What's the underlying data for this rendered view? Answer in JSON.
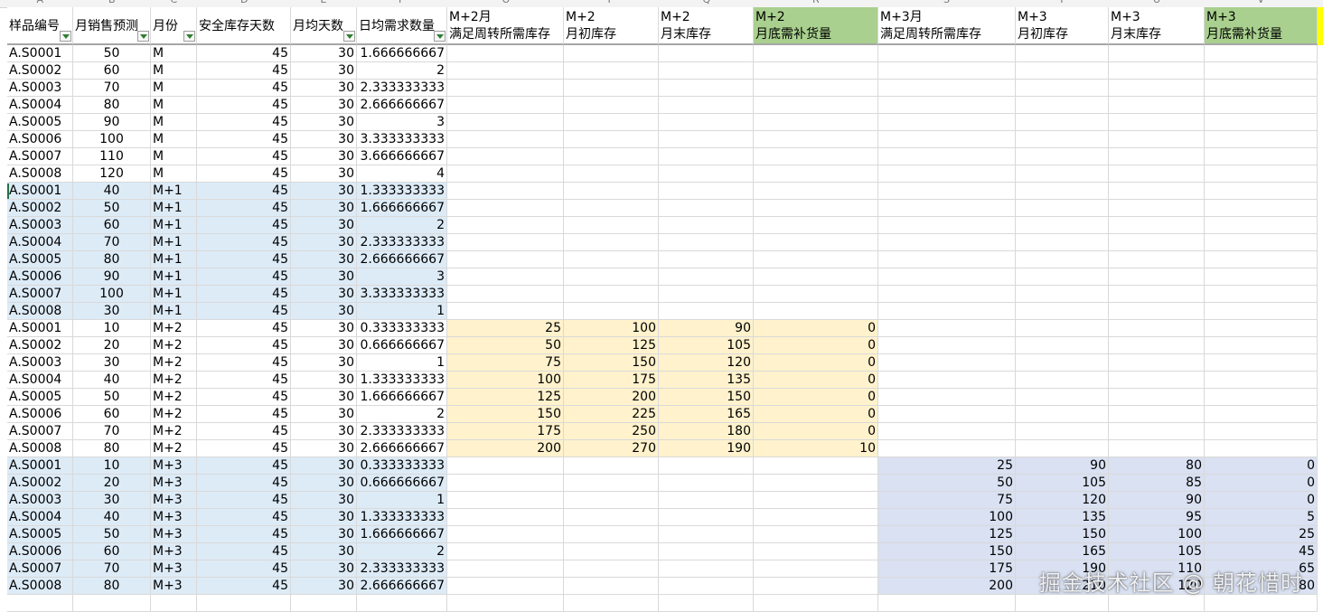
{
  "column_letters": [
    "A",
    "B",
    "C",
    "D",
    "E",
    "F",
    "O",
    "P",
    "Q",
    "R",
    "S",
    "T",
    "U",
    "V"
  ],
  "headers": {
    "sample_id": "样品编号",
    "monthly_forecast": "月销售预测",
    "month": "月份",
    "safety_days": "安全库存天数",
    "avg_days": "月均天数",
    "daily_demand": "日均需求数量",
    "m2_turnover_l1": "M+2月",
    "m2_turnover_l2": "满足周转所需库存",
    "m2_open_l1": "M+2",
    "m2_open_l2": "月初库存",
    "m2_close_l1": "M+2",
    "m2_close_l2": "月末库存",
    "m2_replen_l1": "M+2",
    "m2_replen_l2": "月底需补货量",
    "m3_turnover_l1": "M+3月",
    "m3_turnover_l2": "满足周转所需库存",
    "m3_open_l1": "M+3",
    "m3_open_l2": "月初库存",
    "m3_close_l1": "M+3",
    "m3_close_l2": "月末库存",
    "m3_replen_l1": "M+3",
    "m3_replen_l2": "月底需补货量"
  },
  "rows": [
    {
      "id": "A.S0001",
      "forecast": "50",
      "month": "M",
      "safety": "45",
      "avg": "30",
      "daily": "1.666666667"
    },
    {
      "id": "A.S0002",
      "forecast": "60",
      "month": "M",
      "safety": "45",
      "avg": "30",
      "daily": "2"
    },
    {
      "id": "A.S0003",
      "forecast": "70",
      "month": "M",
      "safety": "45",
      "avg": "30",
      "daily": "2.333333333"
    },
    {
      "id": "A.S0004",
      "forecast": "80",
      "month": "M",
      "safety": "45",
      "avg": "30",
      "daily": "2.666666667"
    },
    {
      "id": "A.S0005",
      "forecast": "90",
      "month": "M",
      "safety": "45",
      "avg": "30",
      "daily": "3"
    },
    {
      "id": "A.S0006",
      "forecast": "100",
      "month": "M",
      "safety": "45",
      "avg": "30",
      "daily": "3.333333333"
    },
    {
      "id": "A.S0007",
      "forecast": "110",
      "month": "M",
      "safety": "45",
      "avg": "30",
      "daily": "3.666666667"
    },
    {
      "id": "A.S0008",
      "forecast": "120",
      "month": "M",
      "safety": "45",
      "avg": "30",
      "daily": "4"
    },
    {
      "id": "A.S0001",
      "forecast": "40",
      "month": "M+1",
      "safety": "45",
      "avg": "30",
      "daily": "1.333333333"
    },
    {
      "id": "A.S0002",
      "forecast": "50",
      "month": "M+1",
      "safety": "45",
      "avg": "30",
      "daily": "1.666666667"
    },
    {
      "id": "A.S0003",
      "forecast": "60",
      "month": "M+1",
      "safety": "45",
      "avg": "30",
      "daily": "2"
    },
    {
      "id": "A.S0004",
      "forecast": "70",
      "month": "M+1",
      "safety": "45",
      "avg": "30",
      "daily": "2.333333333"
    },
    {
      "id": "A.S0005",
      "forecast": "80",
      "month": "M+1",
      "safety": "45",
      "avg": "30",
      "daily": "2.666666667"
    },
    {
      "id": "A.S0006",
      "forecast": "90",
      "month": "M+1",
      "safety": "45",
      "avg": "30",
      "daily": "3"
    },
    {
      "id": "A.S0007",
      "forecast": "100",
      "month": "M+1",
      "safety": "45",
      "avg": "30",
      "daily": "3.333333333"
    },
    {
      "id": "A.S0008",
      "forecast": "30",
      "month": "M+1",
      "safety": "45",
      "avg": "30",
      "daily": "1"
    },
    {
      "id": "A.S0001",
      "forecast": "10",
      "month": "M+2",
      "safety": "45",
      "avg": "30",
      "daily": "0.333333333",
      "m2": [
        "25",
        "100",
        "90",
        "0"
      ]
    },
    {
      "id": "A.S0002",
      "forecast": "20",
      "month": "M+2",
      "safety": "45",
      "avg": "30",
      "daily": "0.666666667",
      "m2": [
        "50",
        "125",
        "105",
        "0"
      ]
    },
    {
      "id": "A.S0003",
      "forecast": "30",
      "month": "M+2",
      "safety": "45",
      "avg": "30",
      "daily": "1",
      "m2": [
        "75",
        "150",
        "120",
        "0"
      ]
    },
    {
      "id": "A.S0004",
      "forecast": "40",
      "month": "M+2",
      "safety": "45",
      "avg": "30",
      "daily": "1.333333333",
      "m2": [
        "100",
        "175",
        "135",
        "0"
      ]
    },
    {
      "id": "A.S0005",
      "forecast": "50",
      "month": "M+2",
      "safety": "45",
      "avg": "30",
      "daily": "1.666666667",
      "m2": [
        "125",
        "200",
        "150",
        "0"
      ]
    },
    {
      "id": "A.S0006",
      "forecast": "60",
      "month": "M+2",
      "safety": "45",
      "avg": "30",
      "daily": "2",
      "m2": [
        "150",
        "225",
        "165",
        "0"
      ]
    },
    {
      "id": "A.S0007",
      "forecast": "70",
      "month": "M+2",
      "safety": "45",
      "avg": "30",
      "daily": "2.333333333",
      "m2": [
        "175",
        "250",
        "180",
        "0"
      ]
    },
    {
      "id": "A.S0008",
      "forecast": "80",
      "month": "M+2",
      "safety": "45",
      "avg": "30",
      "daily": "2.666666667",
      "m2": [
        "200",
        "270",
        "190",
        "10"
      ]
    },
    {
      "id": "A.S0001",
      "forecast": "10",
      "month": "M+3",
      "safety": "45",
      "avg": "30",
      "daily": "0.333333333",
      "m3": [
        "25",
        "90",
        "80",
        "0"
      ]
    },
    {
      "id": "A.S0002",
      "forecast": "20",
      "month": "M+3",
      "safety": "45",
      "avg": "30",
      "daily": "0.666666667",
      "m3": [
        "50",
        "105",
        "85",
        "0"
      ]
    },
    {
      "id": "A.S0003",
      "forecast": "30",
      "month": "M+3",
      "safety": "45",
      "avg": "30",
      "daily": "1",
      "m3": [
        "75",
        "120",
        "90",
        "0"
      ]
    },
    {
      "id": "A.S0004",
      "forecast": "40",
      "month": "M+3",
      "safety": "45",
      "avg": "30",
      "daily": "1.333333333",
      "m3": [
        "100",
        "135",
        "95",
        "5"
      ]
    },
    {
      "id": "A.S0005",
      "forecast": "50",
      "month": "M+3",
      "safety": "45",
      "avg": "30",
      "daily": "1.666666667",
      "m3": [
        "125",
        "150",
        "100",
        "25"
      ]
    },
    {
      "id": "A.S0006",
      "forecast": "60",
      "month": "M+3",
      "safety": "45",
      "avg": "30",
      "daily": "2",
      "m3": [
        "150",
        "165",
        "105",
        "45"
      ]
    },
    {
      "id": "A.S0007",
      "forecast": "70",
      "month": "M+3",
      "safety": "45",
      "avg": "30",
      "daily": "2.333333333",
      "m3": [
        "175",
        "190",
        "110",
        "65"
      ]
    },
    {
      "id": "A.S0008",
      "forecast": "80",
      "month": "M+3",
      "safety": "45",
      "avg": "30",
      "daily": "2.666666667",
      "m3": [
        "200",
        "210",
        "120",
        "80"
      ]
    }
  ],
  "watermark": "掘金技术社区 @ 朝花惜时",
  "colors": {
    "header_green": "#a9d08e",
    "band_blue": "#ddebf7",
    "band_cream": "#fff2cc",
    "band_slate": "#d9e1f2",
    "accent_yellow": "#ffff00"
  }
}
